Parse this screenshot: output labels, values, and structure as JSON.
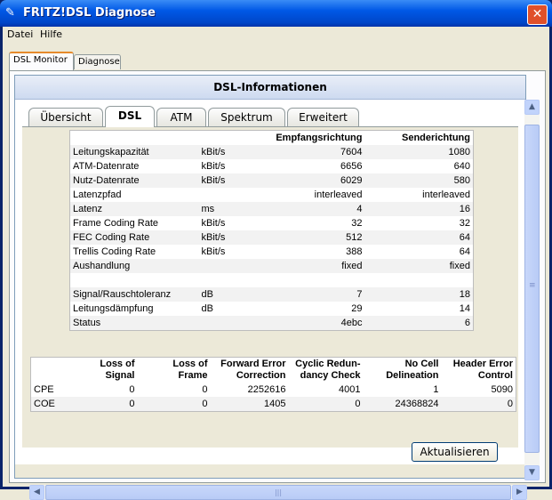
{
  "window": {
    "title": "FRITZ!DSL Diagnose"
  },
  "menu": [
    "Datei",
    "Hilfe"
  ],
  "outer_tabs": [
    "DSL Monitor",
    "Diagnose"
  ],
  "panel_title": "DSL-Informationen",
  "inner_tabs": [
    "Übersicht",
    "DSL",
    "ATM",
    "Spektrum",
    "Erweitert"
  ],
  "dsl_table": {
    "headers": [
      "",
      "",
      "Empfangsrichtung",
      "Senderichtung"
    ],
    "rows": [
      {
        "label": "Leitungskapazität",
        "unit": "kBit/s",
        "rx": "7604",
        "tx": "1080"
      },
      {
        "label": "ATM-Datenrate",
        "unit": "kBit/s",
        "rx": "6656",
        "tx": "640"
      },
      {
        "label": "Nutz-Datenrate",
        "unit": "kBit/s",
        "rx": "6029",
        "tx": "580"
      },
      {
        "label": "Latenzpfad",
        "unit": "",
        "rx": "interleaved",
        "tx": "interleaved"
      },
      {
        "label": "Latenz",
        "unit": "ms",
        "rx": "4",
        "tx": "16"
      },
      {
        "label": "Frame Coding Rate",
        "unit": "kBit/s",
        "rx": "32",
        "tx": "32"
      },
      {
        "label": "FEC Coding Rate",
        "unit": "kBit/s",
        "rx": "512",
        "tx": "64"
      },
      {
        "label": "Trellis Coding Rate",
        "unit": "kBit/s",
        "rx": "388",
        "tx": "64"
      },
      {
        "label": "Aushandlung",
        "unit": "",
        "rx": "fixed",
        "tx": "fixed"
      },
      {
        "label": "",
        "unit": "",
        "rx": "",
        "tx": ""
      },
      {
        "label": "Signal/Rauschtoleranz",
        "unit": "dB",
        "rx": "7",
        "tx": "18"
      },
      {
        "label": "Leitungsdämpfung",
        "unit": "dB",
        "rx": "29",
        "tx": "14"
      },
      {
        "label": "Status",
        "unit": "",
        "rx": "4ebc",
        "tx": "6"
      }
    ]
  },
  "error_table": {
    "headers": [
      {
        "l1": "",
        "l2": ""
      },
      {
        "l1": "Loss of",
        "l2": "Signal"
      },
      {
        "l1": "Loss of",
        "l2": "Frame"
      },
      {
        "l1": "Forward Error",
        "l2": "Correction"
      },
      {
        "l1": "Cyclic Redun-",
        "l2": "dancy Check"
      },
      {
        "l1": "No Cell",
        "l2": "Delineation"
      },
      {
        "l1": "Header Error",
        "l2": "Control"
      }
    ],
    "rows": [
      {
        "name": "CPE",
        "values": [
          "0",
          "0",
          "2252616",
          "4001",
          "1",
          "5090"
        ]
      },
      {
        "name": "COE",
        "values": [
          "0",
          "0",
          "1405",
          "0",
          "24368824",
          "0"
        ]
      }
    ]
  },
  "buttons": {
    "refresh": "Aktualisieren",
    "close": "✕"
  },
  "scrollbars": {
    "up": "▲",
    "down": "▼",
    "left": "◀",
    "right": "▶",
    "grip_v": "≡",
    "grip_h": "|||"
  },
  "colors": {
    "titlebar": "#0058e6",
    "panel_header": "#cddaf0",
    "active_tab_accent": "#e68b2c"
  }
}
